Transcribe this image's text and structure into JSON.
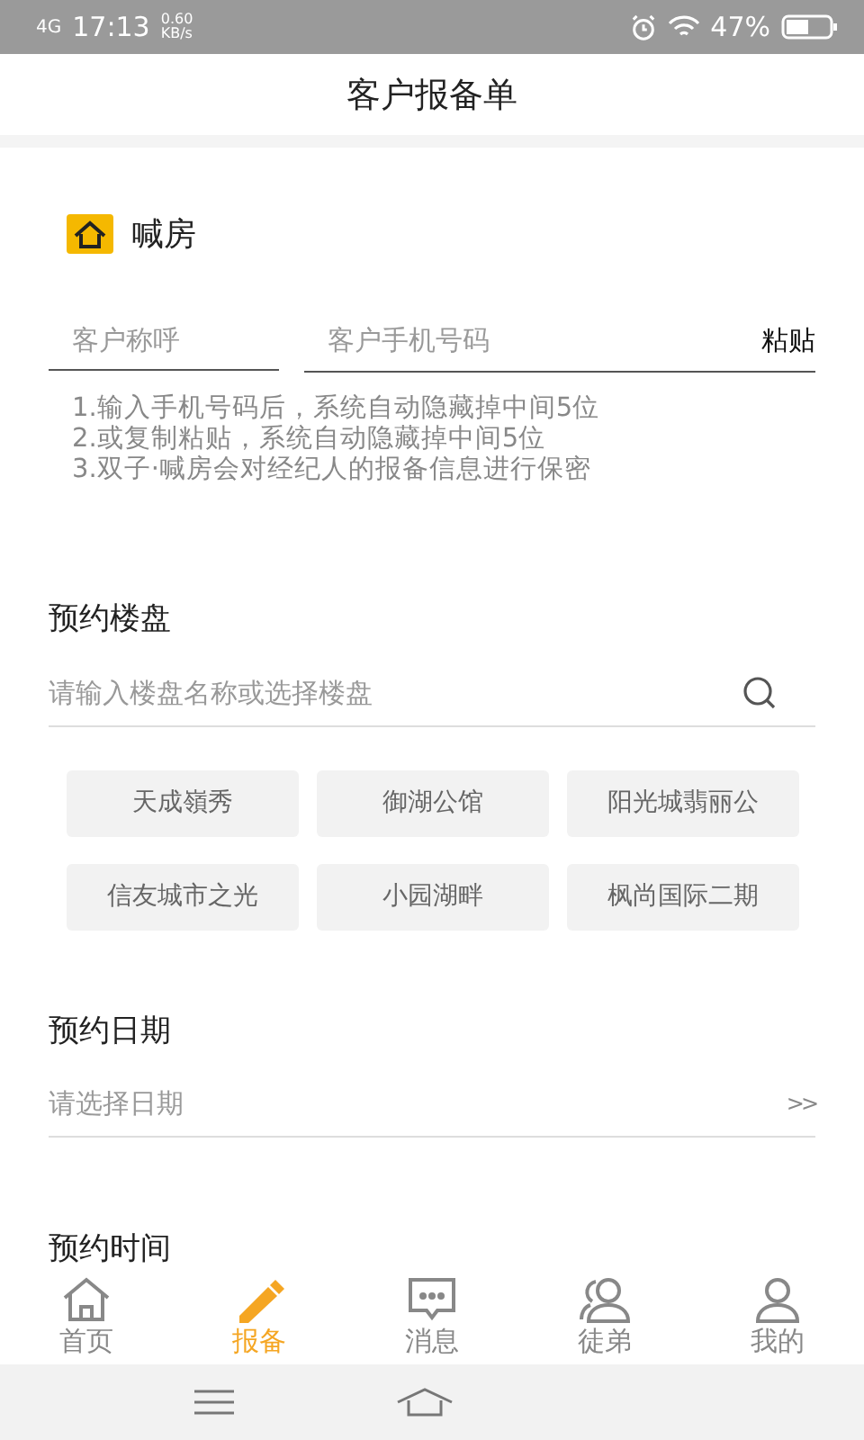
{
  "status_bar": {
    "network": "4G",
    "time": "17:13",
    "speed": "0.60",
    "speed_unit": "KB/s",
    "battery": "47%"
  },
  "header": {
    "title": "客户报备单"
  },
  "brand": {
    "name": "喊房"
  },
  "customer": {
    "name_placeholder": "客户称呼",
    "phone_placeholder": "客户手机号码",
    "paste_button": "粘贴"
  },
  "notes": [
    "1.输入手机号码后，系统自动隐藏掉中间5位",
    "2.或复制粘贴，系统自动隐藏掉中间5位",
    "3.双子·喊房会对经纪人的报备信息进行保密"
  ],
  "property": {
    "heading": "预约楼盘",
    "placeholder": "请输入楼盘名称或选择楼盘"
  },
  "chips": [
    {
      "label": "天成嶺秀"
    },
    {
      "label": "御湖公馆"
    },
    {
      "label": "阳光城翡丽公"
    },
    {
      "label": "信友城市之光"
    },
    {
      "label": "小园湖畔"
    },
    {
      "label": "枫尚国际二期"
    }
  ],
  "date": {
    "heading": "预约日期",
    "placeholder": "请选择日期",
    "arrow": ">>"
  },
  "time": {
    "heading": "预约时间"
  },
  "nav": [
    {
      "label": "首页",
      "kind": "home",
      "selected": false
    },
    {
      "label": "报备",
      "kind": "pencil",
      "selected": true
    },
    {
      "label": "消息",
      "kind": "message",
      "selected": false
    },
    {
      "label": "徒弟",
      "kind": "users",
      "selected": false
    },
    {
      "label": "我的",
      "kind": "user",
      "selected": false
    }
  ]
}
